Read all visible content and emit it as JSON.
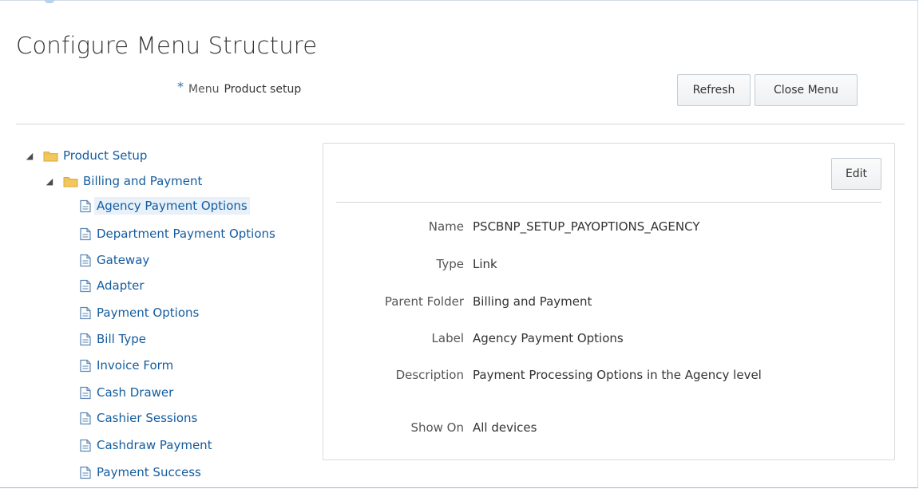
{
  "page": {
    "title": "Configure Menu Structure"
  },
  "menu_field": {
    "required_marker": "*",
    "label": "Menu",
    "value": "Product setup"
  },
  "toolbar": {
    "refresh_label": "Refresh",
    "close_menu_label": "Close Menu"
  },
  "tree": {
    "root": {
      "label": "Product Setup",
      "icon": "folder-icon",
      "expanded": true
    },
    "folder": {
      "label": "Billing and Payment",
      "icon": "folder-icon",
      "expanded": true
    },
    "items": [
      {
        "label": "Agency Payment Options",
        "icon": "page-icon",
        "selected": true
      },
      {
        "label": "Department Payment Options",
        "icon": "page-icon"
      },
      {
        "label": "Gateway",
        "icon": "page-icon"
      },
      {
        "label": "Adapter",
        "icon": "page-icon"
      },
      {
        "label": "Payment Options",
        "icon": "page-icon"
      },
      {
        "label": "Bill Type",
        "icon": "page-icon"
      },
      {
        "label": "Invoice Form",
        "icon": "page-icon"
      },
      {
        "label": "Cash Drawer",
        "icon": "page-icon"
      },
      {
        "label": "Cashier Sessions",
        "icon": "page-icon"
      },
      {
        "label": "Cashdraw Payment",
        "icon": "page-icon"
      },
      {
        "label": "Payment Success",
        "icon": "page-icon"
      }
    ]
  },
  "detail": {
    "edit_label": "Edit",
    "fields": [
      {
        "label": "Name",
        "value": "PSCBNP_SETUP_PAYOPTIONS_AGENCY"
      },
      {
        "label": "Type",
        "value": "Link"
      },
      {
        "label": "Parent Folder",
        "value": "Billing and Payment"
      },
      {
        "label": "Label",
        "value": "Agency Payment Options"
      },
      {
        "label": "Description",
        "value": "Payment Processing Options in the Agency level"
      },
      {
        "label": "Show On",
        "value": "All devices"
      }
    ]
  },
  "colors": {
    "link": "#145c9e",
    "required_marker": "#2f6fad",
    "selected_bg": "#e8f1fa",
    "folder": "#f2c75c"
  }
}
